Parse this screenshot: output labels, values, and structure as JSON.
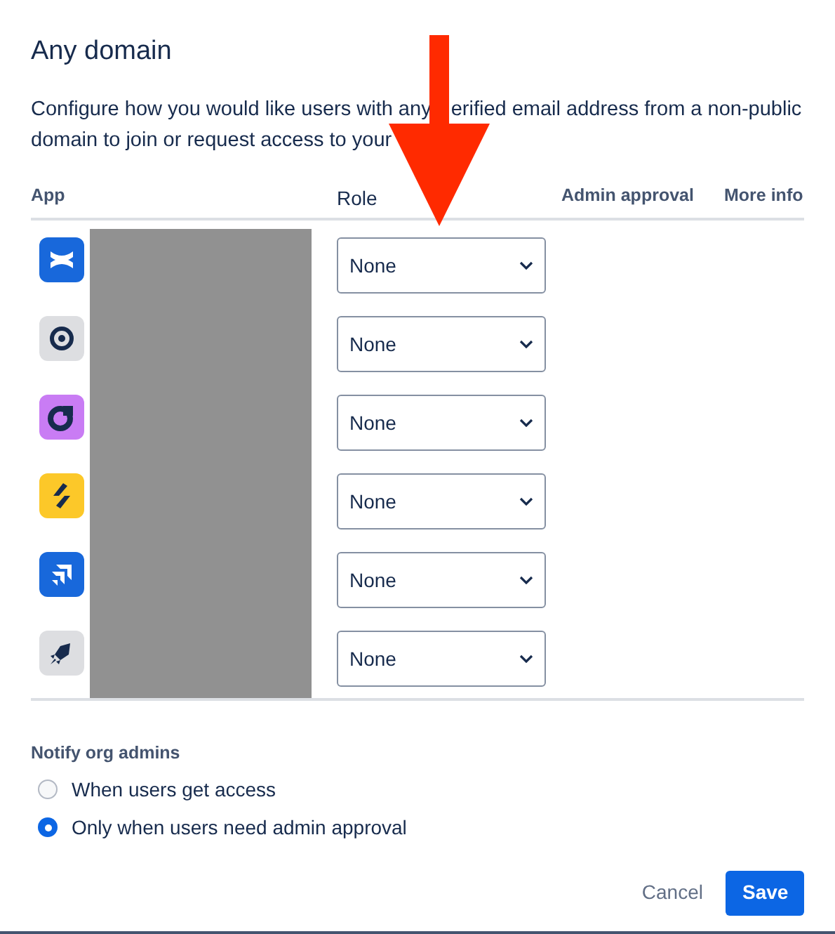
{
  "title": "Any domain",
  "description": [
    "Configure how you would like users with any",
    "erified email address from a non-public",
    "domain to join or request access to your"
  ],
  "table": {
    "columns": [
      "App",
      "Role",
      "Admin approval",
      "More info"
    ],
    "rows": [
      {
        "color": "#1868db",
        "role": "None"
      },
      {
        "color": "#dddee1",
        "role": "None"
      },
      {
        "color": "#c97cf4",
        "role": "None"
      },
      {
        "color": "#fcc829",
        "role": "None"
      },
      {
        "color": "#1868db",
        "role": "None"
      },
      {
        "color": "#dddee1",
        "role": "None"
      }
    ]
  },
  "notify": {
    "label": "Notify org admins",
    "options": [
      {
        "label": "When users get access",
        "selected": false
      },
      {
        "label": "Only when users need admin approval",
        "selected": true
      }
    ]
  },
  "buttons": {
    "cancel": "Cancel",
    "save": "Save"
  }
}
